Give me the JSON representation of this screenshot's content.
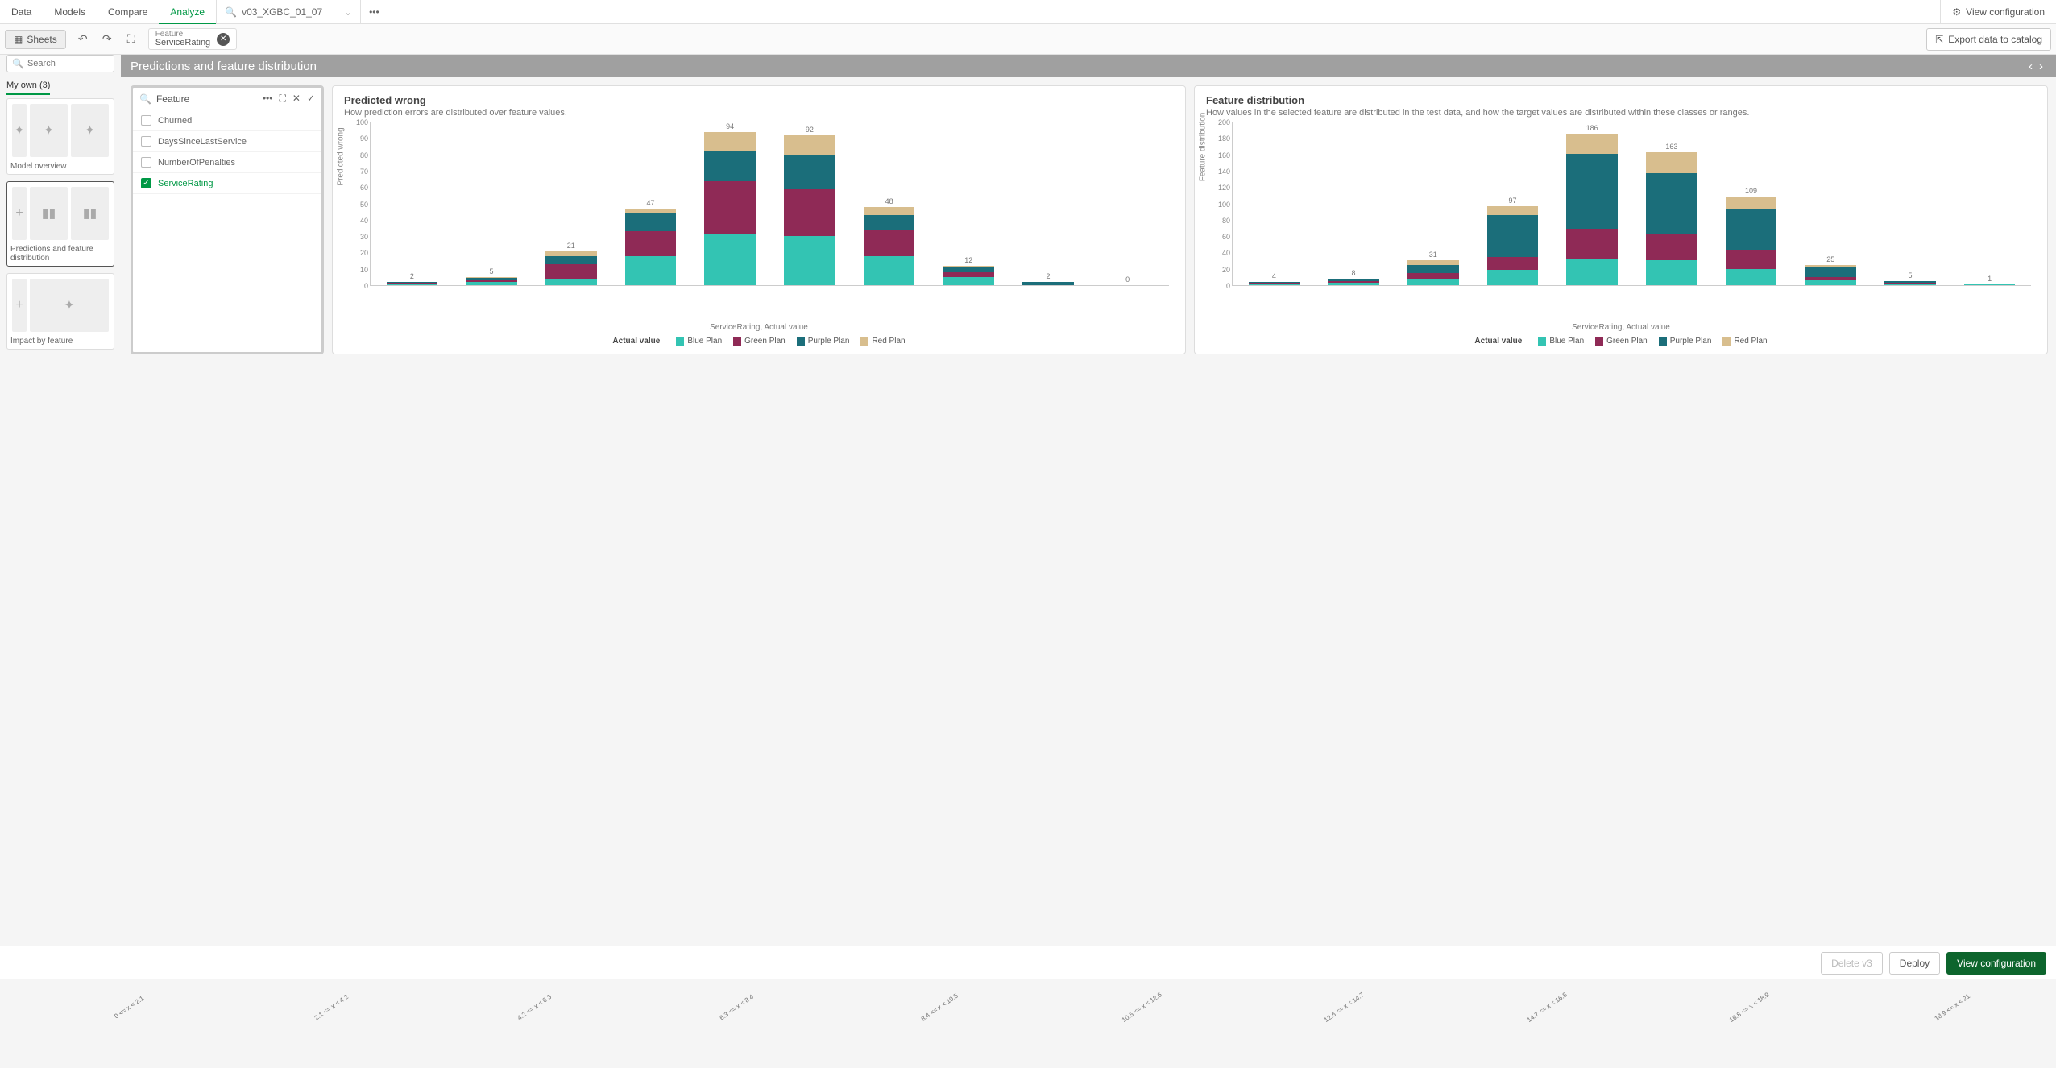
{
  "tabs": [
    "Data",
    "Models",
    "Compare",
    "Analyze"
  ],
  "active_tab": "Analyze",
  "model_name": "v03_XGBC_01_07",
  "header": {
    "view_config": "View configuration",
    "sheets": "Sheets",
    "chip_title": "Feature",
    "chip_value": "ServiceRating",
    "export": "Export data to catalog",
    "page_title": "Predictions and feature distribution"
  },
  "sidebar": {
    "search_placeholder": "Search",
    "my_own": "My own (3)",
    "thumbs": [
      {
        "label": "Model overview"
      },
      {
        "label": "Predictions and feature distribution"
      },
      {
        "label": "Impact by feature"
      }
    ]
  },
  "feature_panel": {
    "title": "Feature",
    "items": [
      {
        "label": "Churned",
        "checked": false
      },
      {
        "label": "DaysSinceLastService",
        "checked": false
      },
      {
        "label": "NumberOfPenalties",
        "checked": false
      },
      {
        "label": "ServiceRating",
        "checked": true
      }
    ]
  },
  "legend": {
    "title": "Actual value",
    "items": [
      "Blue Plan",
      "Green Plan",
      "Purple Plan",
      "Red Plan"
    ]
  },
  "footer": {
    "delete": "Delete v3",
    "deploy": "Deploy",
    "view_config": "View configuration"
  },
  "chart_data": [
    {
      "type": "bar",
      "title": "Predicted wrong",
      "subtitle": "How prediction errors are distributed over feature values.",
      "ylabel": "Predicted wrong",
      "xlabel": "ServiceRating, Actual value",
      "ylim": [
        0,
        100
      ],
      "categories": [
        "0 <= x < 2.1",
        "2.1 <= x < 4.2",
        "4.2 <= x < 6.3",
        "6.3 <= x < 8.4",
        "8.4 <= x < 10.5",
        "10.5 <= x < 12.6",
        "12.6 <= x < 14.7",
        "14.7 <= x < 16.8",
        "16.8 <= x < 18.9",
        "18.9 <= x < 21"
      ],
      "totals": [
        2,
        5,
        21,
        47,
        94,
        92,
        48,
        12,
        2,
        0
      ],
      "series": [
        {
          "name": "Blue Plan",
          "values": [
            1,
            2,
            4,
            18,
            31,
            30,
            18,
            5,
            0,
            0
          ]
        },
        {
          "name": "Green Plan",
          "values": [
            0.5,
            1,
            9,
            15,
            33,
            29,
            16,
            3,
            0,
            0
          ]
        },
        {
          "name": "Purple Plan",
          "values": [
            0.5,
            1.5,
            5,
            11,
            18,
            21,
            9,
            3,
            2,
            0
          ]
        },
        {
          "name": "Red Plan",
          "values": [
            0,
            0.5,
            3,
            3,
            12,
            12,
            5,
            1,
            0,
            0
          ]
        }
      ]
    },
    {
      "type": "bar",
      "title": "Feature distribution",
      "subtitle": "How values in the selected feature are distributed in the test data, and how the target values are distributed within these classes or ranges.",
      "ylabel": "Feature distribution",
      "xlabel": "ServiceRating, Actual value",
      "ylim": [
        0,
        200
      ],
      "categories": [
        "0 <= x < 2.1",
        "2.1 <= x < 4.2",
        "4.2 <= x < 6.3",
        "6.3 <= x < 8.4",
        "8.4 <= x < 10.5",
        "10.5 <= x < 12.6",
        "12.6 <= x < 14.7",
        "14.7 <= x < 16.8",
        "16.8 <= x < 18.9",
        "18.9 <= x < 21"
      ],
      "totals": [
        4,
        8,
        31,
        97,
        186,
        163,
        109,
        25,
        5,
        1
      ],
      "series": [
        {
          "name": "Blue Plan",
          "values": [
            2,
            3,
            8,
            19,
            32,
            31,
            20,
            6,
            2,
            1
          ]
        },
        {
          "name": "Green Plan",
          "values": [
            1,
            2,
            7,
            16,
            37,
            31,
            23,
            4,
            1,
            0
          ]
        },
        {
          "name": "Purple Plan",
          "values": [
            1,
            2,
            10,
            51,
            92,
            76,
            51,
            13,
            2,
            0
          ]
        },
        {
          "name": "Red Plan",
          "values": [
            0,
            1,
            6,
            11,
            25,
            25,
            15,
            2,
            0,
            0
          ]
        }
      ]
    }
  ]
}
